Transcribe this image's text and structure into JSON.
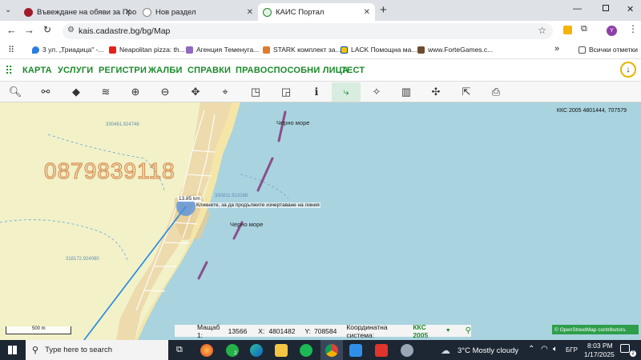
{
  "browser": {
    "tabs": [
      {
        "label": "Въвеждане на обяви за Прод",
        "active": false
      },
      {
        "label": "Нов раздел",
        "active": false
      },
      {
        "label": "КАИС Портал",
        "active": true
      }
    ],
    "new_tab": "+",
    "url": "kais.cadastre.bg/bg/Map",
    "profile_initial": "Y",
    "bookmarks": [
      "3 ул. „Триадица\" -...",
      "Neapolitan pizza: th...",
      "Агенция Теменуга...",
      "STARK комплект за...",
      "LACK Помощна ма...",
      "www.ForteGames.c..."
    ],
    "all_bookmarks": "Всички отметки",
    "more_bookmarks": "»"
  },
  "menu": {
    "items": [
      "КАРТА",
      "УСЛУГИ",
      "РЕГИСТРИ",
      "ЖАЛБИ",
      "СПРАВКИ",
      "ПРАВОСПОСОБНИ ЛИЦА",
      "ТЕСТ"
    ]
  },
  "toolbar": {
    "tools": [
      "search-icon",
      "connections-icon",
      "layer-icon",
      "layers-icon",
      "zoom-in-icon",
      "zoom-out-icon",
      "pan-icon",
      "location-pin-icon",
      "select-area-icon",
      "select-polygon-icon",
      "info-icon",
      "measure-line-icon",
      "measure-area-icon",
      "map-icon",
      "split-icon",
      "export-icon",
      "print-icon"
    ]
  },
  "map": {
    "coordinate_readout": "ККС 2005 4801444, 707579",
    "phone_watermark": "0879839118",
    "parcel_label_1": "330461.924748",
    "parcel_label_2": "318172.924080",
    "parcel_label_3": "330811.913168",
    "sea_label_1": "Черно море",
    "sea_label_2": "Черно море",
    "measurement_text": "13.85 km",
    "measurement_hint": "Кликнете, за да продължите изчертаване на линия",
    "scale_label": "500 m",
    "attribution": "© OpenStreetMap contributors."
  },
  "status": {
    "scale_label": "Мащаб 1:",
    "scale_value": "13566",
    "x_label": "X:",
    "x_value": "4801482",
    "y_label": "Y:",
    "y_value": "708584",
    "coord_system_label": "Координатна система:",
    "coord_system_value": "ККС 2005"
  },
  "taskbar": {
    "search_placeholder": "Type here to search",
    "weather": "3°C  Mostly cloudy",
    "language": "БГР",
    "time": "8:03 PM",
    "date": "1/17/2025",
    "phone_badge": "2",
    "notification_badge": "2"
  },
  "colors": {
    "accent_green": "#1a8a2a",
    "sea": "#a9d3df",
    "land": "#f2f1c8",
    "watermark": "#d9935a"
  }
}
